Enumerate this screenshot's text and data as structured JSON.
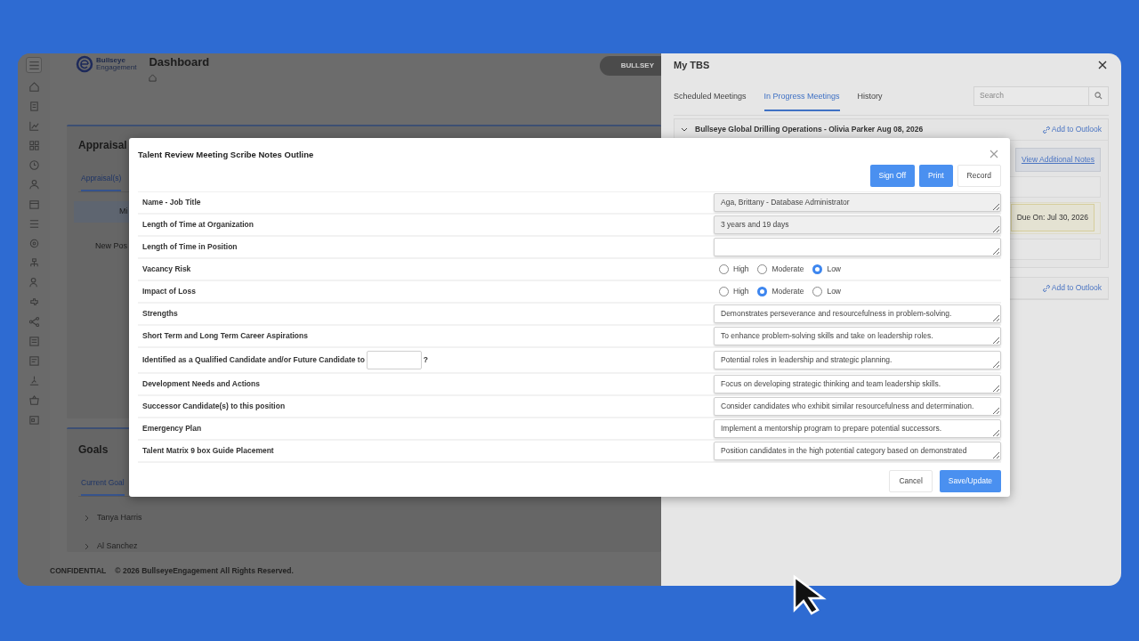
{
  "app": {
    "logo": [
      "Bullseye",
      "Engagement"
    ],
    "page_title": "Dashboard",
    "badge": "BULLSEY"
  },
  "appraisal_card": {
    "title": "Appraisal",
    "tabs": [
      {
        "label": "Appraisal(s)",
        "selected": true
      }
    ],
    "column_header": "Mi",
    "row_text": "New Pos"
  },
  "goals_card": {
    "title": "Goals",
    "tabs": [
      {
        "label": "Current Goal",
        "selected": true
      }
    ],
    "people": [
      {
        "name": "Tanya Harris",
        "expanded": false
      },
      {
        "name": "Al Sanchez",
        "expanded": false
      }
    ]
  },
  "footer": {
    "confidential": "CONFIDENTIAL",
    "copyright": "© 2026 BullseyeEngagement All Rights Reserved."
  },
  "panel": {
    "title": "My TBS",
    "tabs": [
      {
        "label": "Scheduled Meetings",
        "selected": false
      },
      {
        "label": "In Progress Meetings",
        "selected": true
      },
      {
        "label": "History",
        "selected": false
      }
    ],
    "search": {
      "placeholder": "Search"
    },
    "meetings": [
      {
        "title": "Bullseye Global Drilling Operations - Olivia Parker Aug 08, 2026",
        "expanded": true,
        "outlook_link": "Add to Outlook",
        "notes_link": "View Additional Notes",
        "due": "Due On: Jul 30, 2026"
      },
      {
        "outlook_link": "Add to Outlook"
      }
    ]
  },
  "modal": {
    "title": "Talent Review Meeting Scribe Notes Outline",
    "actions": [
      {
        "label": "Sign Off",
        "kind": "primary"
      },
      {
        "label": "Print",
        "kind": "primary"
      },
      {
        "label": "Record",
        "kind": "light"
      }
    ],
    "rows": [
      {
        "kind": "text",
        "label": "Name - Job Title",
        "value": "Aga, Brittany - Database Administrator",
        "readonly": true
      },
      {
        "kind": "text",
        "label": "Length of Time at Organization",
        "value": "3 years and 19 days",
        "readonly": true
      },
      {
        "kind": "text",
        "label": "Length of Time in Position",
        "readonly": false
      },
      {
        "kind": "radio",
        "label": "Vacancy Risk",
        "options": [
          {
            "label": "High",
            "selected": false
          },
          {
            "label": "Moderate",
            "selected": false
          },
          {
            "label": "Low",
            "selected": true
          }
        ]
      },
      {
        "kind": "radio",
        "label": "Impact of Loss",
        "options": [
          {
            "label": "High",
            "selected": false
          },
          {
            "label": "Moderate",
            "selected": true
          },
          {
            "label": "Low",
            "selected": false
          }
        ]
      },
      {
        "kind": "text",
        "label": "Strengths",
        "value": "Demonstrates perseverance and resourcefulness in problem-solving.",
        "readonly": false
      },
      {
        "kind": "text",
        "label": "Short Term and Long Term Career Aspirations",
        "value": "To enhance problem-solving skills and take on leadership roles.",
        "readonly": false
      },
      {
        "kind": "inline",
        "label": "Identified as a Qualified Candidate and/or Future Candidate to",
        "label_after": "?",
        "value": "Potential roles in leadership and strategic planning.",
        "readonly": false
      },
      {
        "kind": "text",
        "label": "Development Needs and Actions",
        "value": "Focus on developing strategic thinking and team leadership skills.",
        "readonly": false
      },
      {
        "kind": "text",
        "label": "Successor Candidate(s) to this position",
        "value": "Consider candidates who exhibit similar resourcefulness and determination.",
        "readonly": false
      },
      {
        "kind": "text",
        "label": "Emergency Plan",
        "value": "Implement a mentorship program to prepare potential successors.",
        "readonly": false
      },
      {
        "kind": "text",
        "label": "Talent Matrix 9 box Guide Placement",
        "value": "Position candidates in the high potential category based on demonstrated",
        "readonly": false
      }
    ],
    "footer_buttons": [
      {
        "label": "Cancel",
        "kind": "light"
      },
      {
        "label": "Save/Update",
        "kind": "primary"
      }
    ]
  }
}
